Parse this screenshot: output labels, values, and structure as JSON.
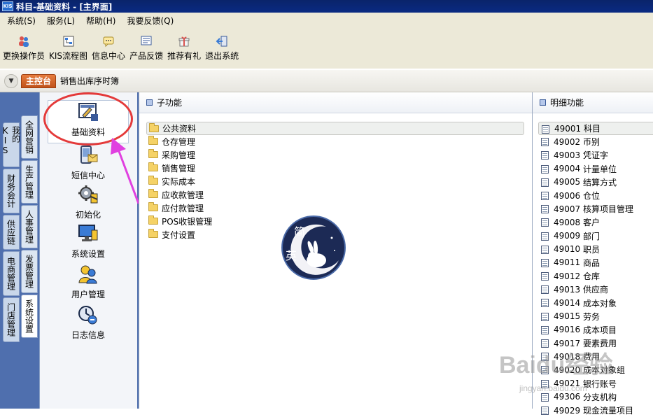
{
  "window": {
    "title": "科目-基础资料 - [主界面]",
    "logo": "KIS"
  },
  "menu": [
    "系统(S)",
    "服务(L)",
    "帮助(H)",
    "我要反馈(Q)"
  ],
  "toolbar": [
    {
      "label": "更换操作员",
      "icon": "switch-user-icon"
    },
    {
      "label": "KIS流程图",
      "icon": "flowchart-icon"
    },
    {
      "label": "信息中心",
      "icon": "info-center-icon"
    },
    {
      "label": "产品反馈",
      "icon": "feedback-icon"
    },
    {
      "label": "推荐有礼",
      "icon": "gift-icon"
    },
    {
      "label": "退出系统",
      "icon": "exit-icon"
    }
  ],
  "nav": {
    "main_tab": "主控台",
    "crumb": "销售出库序时簿"
  },
  "outer_tabs": [
    "我的KIS",
    "财务会计",
    "供应链",
    "电商管理",
    "门店管理"
  ],
  "inner_tabs": [
    {
      "label": "全网营销",
      "active": false
    },
    {
      "label": "生产管理",
      "active": false
    },
    {
      "label": "人事管理",
      "active": false
    },
    {
      "label": "发票管理",
      "active": false
    },
    {
      "label": "系统设置",
      "active": true
    }
  ],
  "modules": [
    {
      "label": "基础资料",
      "icon": "basic-data-icon",
      "selected": true
    },
    {
      "label": "短信中心",
      "icon": "sms-center-icon",
      "selected": false
    },
    {
      "label": "初始化",
      "icon": "initialize-icon",
      "selected": false
    },
    {
      "label": "系统设置",
      "icon": "system-settings-icon",
      "selected": false
    },
    {
      "label": "用户管理",
      "icon": "user-management-icon",
      "selected": false
    },
    {
      "label": "日志信息",
      "icon": "log-info-icon",
      "selected": false
    }
  ],
  "middle": {
    "header": "子功能",
    "items": [
      "公共资料",
      "仓存管理",
      "采购管理",
      "销售管理",
      "实际成本",
      "应收款管理",
      "应付款管理",
      "POS收银管理",
      "支付设置"
    ],
    "selected_index": 0
  },
  "right": {
    "header": "明细功能",
    "items": [
      {
        "code": "49001",
        "name": "科目"
      },
      {
        "code": "49002",
        "name": "币别"
      },
      {
        "code": "49003",
        "name": "凭证字"
      },
      {
        "code": "49004",
        "name": "计量单位"
      },
      {
        "code": "49005",
        "name": "结算方式"
      },
      {
        "code": "49006",
        "name": "仓位"
      },
      {
        "code": "49007",
        "name": "核算项目管理"
      },
      {
        "code": "49008",
        "name": "客户"
      },
      {
        "code": "49009",
        "name": "部门"
      },
      {
        "code": "49010",
        "name": "职员"
      },
      {
        "code": "49011",
        "name": "商品"
      },
      {
        "code": "49012",
        "name": "仓库"
      },
      {
        "code": "49013",
        "name": "供应商"
      },
      {
        "code": "49014",
        "name": "成本对象"
      },
      {
        "code": "49015",
        "name": "劳务"
      },
      {
        "code": "49016",
        "name": "成本项目"
      },
      {
        "code": "49017",
        "name": "要素费用"
      },
      {
        "code": "49018",
        "name": "费用"
      },
      {
        "code": "49020",
        "name": "成本对象组"
      },
      {
        "code": "49021",
        "name": "银行账号"
      },
      {
        "code": "49306",
        "name": "分支机构"
      },
      {
        "code": "49029",
        "name": "现金流量项目"
      }
    ],
    "selected_index": 0
  },
  "watermark": {
    "badge_top": "简",
    "badge_left": "英",
    "baidu": "Baidu经验",
    "baidu_url": "jingyan.baidu.com"
  },
  "colors": {
    "titlebar": "#0a246a",
    "main_tab": "#d0622a",
    "left_bg": "#4f6fae",
    "annotation": "#e43a3a",
    "arrow": "#e040e0"
  }
}
